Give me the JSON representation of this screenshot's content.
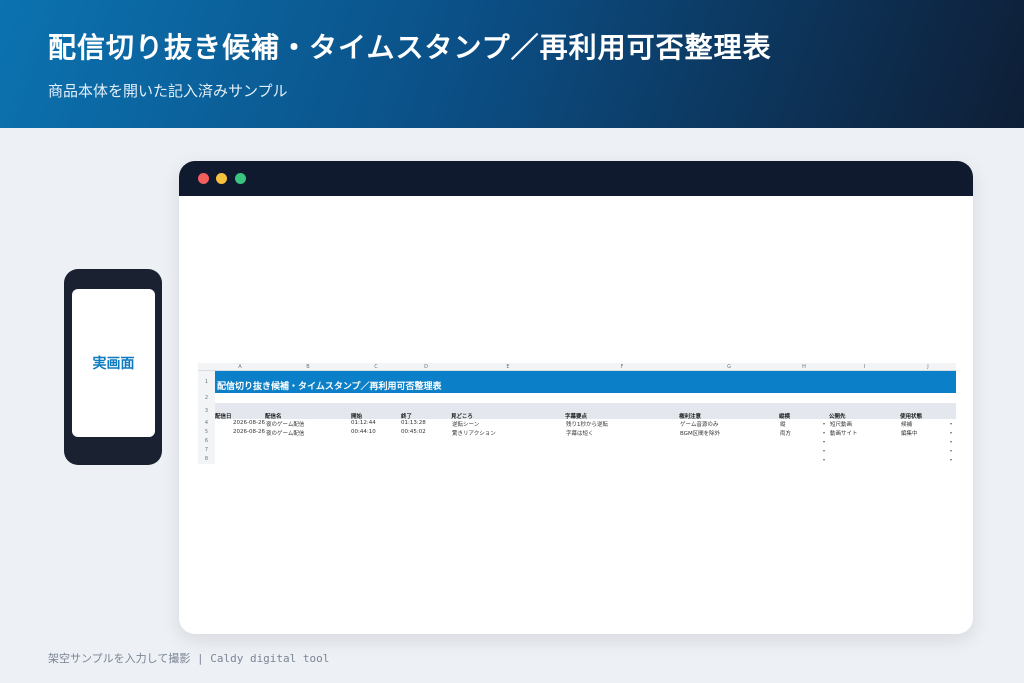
{
  "header": {
    "title": "配信切り抜き候補・タイムスタンプ／再利用可否整理表",
    "subtitle": "商品本体を開いた記入済みサンプル"
  },
  "phone": {
    "label": "実画面"
  },
  "sheet": {
    "columns": [
      "A",
      "B",
      "C",
      "D",
      "E",
      "F",
      "G",
      "H",
      "I",
      "J"
    ],
    "row_numbers": [
      "1",
      "2",
      "3",
      "4",
      "5",
      "6",
      "7",
      "8"
    ],
    "title": "配信切り抜き候補・タイムスタンプ／再利用可否整理表",
    "headers": [
      "配信日",
      "配信名",
      "開始",
      "終了",
      "見どころ",
      "字幕要点",
      "権利注意",
      "縦横",
      "公開先",
      "使用状態"
    ],
    "rows": [
      [
        "2026-08-26",
        "夜のゲーム配信",
        "01:12:44",
        "01:13:28",
        "逆転シーン",
        "残り1秒から逆転",
        "ゲーム音源のみ",
        "縦",
        "短尺動画",
        "候補"
      ],
      [
        "2026-08-26",
        "夜のゲーム配信",
        "00:44:10",
        "00:45:02",
        "驚きリアクション",
        "字幕は短く",
        "BGM区間を除外",
        "両方",
        "動画サイト",
        "編集中"
      ]
    ],
    "dropdown_glyph": "▾"
  },
  "footer": {
    "text": "架空サンプルを入力して撮影 | Caldy digital tool"
  },
  "colors": {
    "accent": "#0b7fc7",
    "header_bg_start": "#0b73b0",
    "header_bg_end": "#0e1e36",
    "titlebar": "#0f1a2e"
  }
}
